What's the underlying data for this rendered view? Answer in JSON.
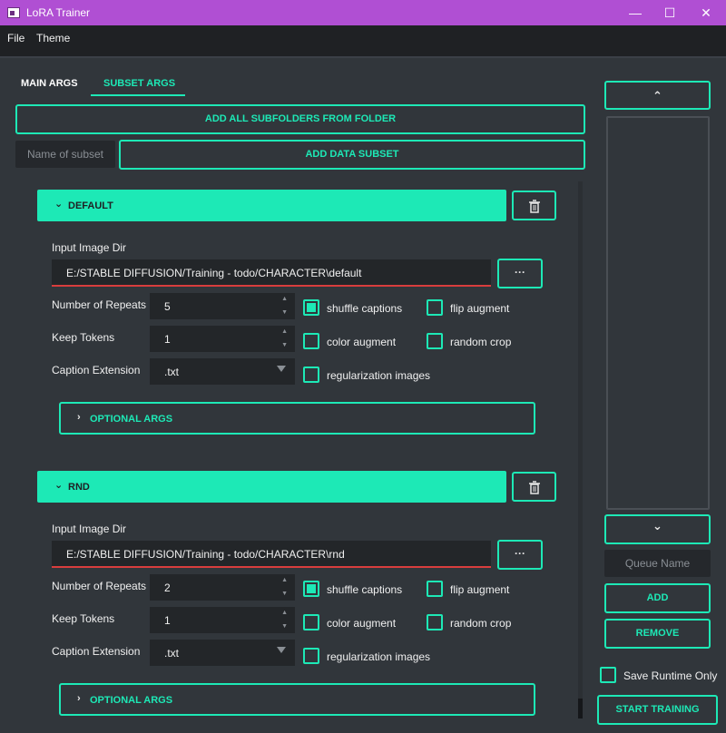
{
  "window": {
    "title": "LoRA Trainer",
    "minimize": "—",
    "maximize": "☐",
    "close": "✕"
  },
  "menu": {
    "file": "File",
    "theme": "Theme"
  },
  "tabs": {
    "main_args": "MAIN ARGS",
    "subset_args": "SUBSET ARGS"
  },
  "toolbar": {
    "add_all_subfolders": "ADD ALL SUBFOLDERS FROM FOLDER",
    "subset_name_placeholder": "Name of subset",
    "add_data_subset": "ADD DATA SUBSET"
  },
  "subsets": [
    {
      "name": "DEFAULT",
      "input_dir_label": "Input Image Dir",
      "input_dir_value": "E:/STABLE DIFFUSION/Training - todo/CHARACTER\\default",
      "browse_label": "···",
      "repeats_label": "Number of Repeats",
      "repeats_value": "5",
      "keep_tokens_label": "Keep Tokens",
      "keep_tokens_value": "1",
      "caption_ext_label": "Caption Extension",
      "caption_ext_value": ".txt",
      "shuffle_captions": {
        "label": "shuffle captions",
        "checked": true
      },
      "flip_augment": {
        "label": "flip augment",
        "checked": false
      },
      "color_augment": {
        "label": "color augment",
        "checked": false
      },
      "random_crop": {
        "label": "random crop",
        "checked": false
      },
      "regularization_images": {
        "label": "regularization images",
        "checked": false
      },
      "optional_args": "OPTIONAL ARGS"
    },
    {
      "name": "RND",
      "input_dir_label": "Input Image Dir",
      "input_dir_value": "E:/STABLE DIFFUSION/Training - todo/CHARACTER\\rnd",
      "browse_label": "···",
      "repeats_label": "Number of Repeats",
      "repeats_value": "2",
      "keep_tokens_label": "Keep Tokens",
      "keep_tokens_value": "1",
      "caption_ext_label": "Caption Extension",
      "caption_ext_value": ".txt",
      "shuffle_captions": {
        "label": "shuffle captions",
        "checked": true
      },
      "flip_augment": {
        "label": "flip augment",
        "checked": false
      },
      "color_augment": {
        "label": "color augment",
        "checked": false
      },
      "random_crop": {
        "label": "random crop",
        "checked": false
      },
      "regularization_images": {
        "label": "regularization images",
        "checked": false
      },
      "optional_args": "OPTIONAL ARGS"
    }
  ],
  "queue": {
    "up_icon": "⌃",
    "down_icon": "⌄",
    "name_placeholder": "Queue Name",
    "add": "ADD",
    "remove": "REMOVE",
    "save_runtime_only": "Save Runtime Only",
    "start_training": "START TRAINING"
  },
  "icons": {
    "collapse_open": "chevron-down-icon",
    "collapse_closed": "chevron-right-icon",
    "delete": "trash-icon"
  },
  "colors": {
    "accent": "#1de9b6",
    "titlebar": "#b04fd3",
    "background": "#31363b",
    "error_underline": "#d93d3d"
  }
}
